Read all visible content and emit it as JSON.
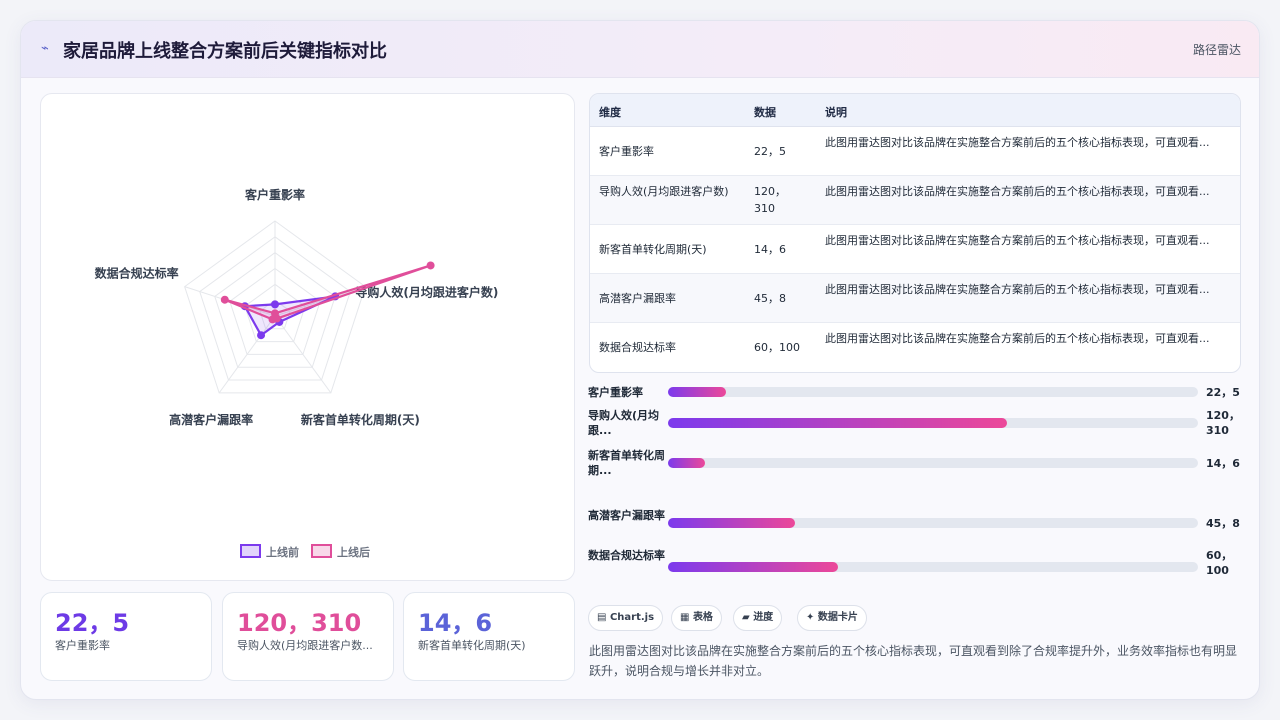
{
  "header": {
    "icon": "chart-line-icon",
    "icon_glyph": "⌁",
    "title": "家居品牌上线整合方案前后关键指标对比",
    "badge": "路径雷达"
  },
  "chart_data": {
    "type": "radar",
    "categories": [
      "客户重影率",
      "导购人效(月均跟进客户数)",
      "新客首单转化周期(天)",
      "高潜客户漏跟率",
      "数据合规达标率"
    ],
    "series": [
      {
        "name": "上线前",
        "values": [
          22,
          120,
          14,
          45,
          60
        ],
        "color": "#7c3aed"
      },
      {
        "name": "上线后",
        "values": [
          5,
          310,
          6,
          8,
          100
        ],
        "color": "#e04e9a"
      }
    ],
    "rlim": [
      0,
      180
    ],
    "grid": true,
    "legend_position": "bottom"
  },
  "stats": [
    {
      "value": "22，5",
      "label": "客户重影率",
      "color": "#6d3ae6"
    },
    {
      "value": "120，310",
      "label": "导购人效(月均跟进客户数...",
      "color": "#e04e9a"
    },
    {
      "value": "14，6",
      "label": "新客首单转化周期(天)",
      "color": "#5b63d8"
    }
  ],
  "table": {
    "headers": [
      "维度",
      "数据",
      "说明"
    ],
    "rows": [
      {
        "dim": "客户重影率",
        "data": "22，5",
        "desc": "此图用雷达图对比该品牌在实施整合方案前后的五个核心指标表现，可直观看..."
      },
      {
        "dim": "导购人效(月均跟进客户数)",
        "data": "120，310",
        "desc": "此图用雷达图对比该品牌在实施整合方案前后的五个核心指标表现，可直观看..."
      },
      {
        "dim": "新客首单转化周期(天)",
        "data": "14，6",
        "desc": "此图用雷达图对比该品牌在实施整合方案前后的五个核心指标表现，可直观看..."
      },
      {
        "dim": "高潜客户漏跟率",
        "data": "45，8",
        "desc": "此图用雷达图对比该品牌在实施整合方案前后的五个核心指标表现，可直观看..."
      },
      {
        "dim": "数据合规达标率",
        "data": "60，100",
        "desc": "此图用雷达图对比该品牌在实施整合方案前后的五个核心指标表现，可直观看..."
      }
    ]
  },
  "bars": [
    {
      "label": "客户重影率",
      "value": "22，5",
      "fraction": 0.11
    },
    {
      "label": "导购人效(月均跟...",
      "value": "120，310",
      "fraction": 0.64
    },
    {
      "label": "新客首单转化周期...",
      "value": "14，6",
      "fraction": 0.07
    },
    {
      "label": "高潜客户漏跟率",
      "value": "45，8",
      "fraction": 0.24
    },
    {
      "label": "数据合规达标率",
      "value": "60，100",
      "fraction": 0.32
    }
  ],
  "chips": [
    {
      "icon": "chart-icon",
      "glyph": "▤",
      "label": "Chart.js"
    },
    {
      "icon": "table-icon",
      "glyph": "▦",
      "label": "表格"
    },
    {
      "icon": "progress-icon",
      "glyph": "▰",
      "label": "进度"
    },
    {
      "icon": "sparkle-icon",
      "glyph": "✦",
      "label": "数据卡片"
    }
  ],
  "description": "此图用雷达图对比该品牌在实施整合方案前后的五个核心指标表现，可直观看到除了合规率提升外，业务效率指标也有明显跃升，说明合规与增长并非对立。"
}
